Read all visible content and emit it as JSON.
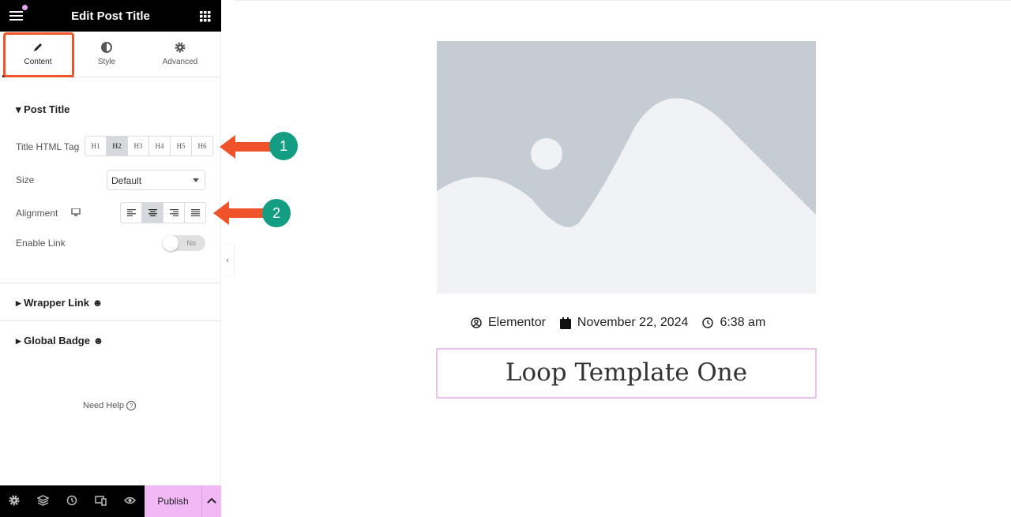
{
  "header": {
    "title": "Edit Post Title",
    "menu_icon": "hamburger-icon",
    "apps_icon": "grid-icon"
  },
  "tabs": [
    {
      "label": "Content",
      "icon": "pencil-icon",
      "active": true
    },
    {
      "label": "Style",
      "icon": "half-circle-icon"
    },
    {
      "label": "Advanced",
      "icon": "gear-icon"
    }
  ],
  "section": {
    "title": "Post Title",
    "html_tag": {
      "label": "Title HTML Tag",
      "options": [
        "H1",
        "H2",
        "H3",
        "H4",
        "H5",
        "H6"
      ],
      "selected": "H2"
    },
    "size": {
      "label": "Size",
      "value": "Default"
    },
    "alignment": {
      "label": "Alignment",
      "device_icon": "desktop-icon",
      "options": [
        "left",
        "center",
        "right",
        "justify"
      ],
      "selected": "center"
    },
    "enable_link": {
      "label": "Enable Link",
      "value": "No"
    }
  },
  "sections": [
    "Wrapper Link",
    "Global Badge"
  ],
  "help": "Need Help",
  "footer": {
    "icons": [
      "gear-icon",
      "layers-icon",
      "history-icon",
      "responsive-icon",
      "eye-icon"
    ],
    "publish": "Publish"
  },
  "annotations": [
    "1",
    "2"
  ],
  "colors": {
    "accent": "#f2b8f5",
    "arrow": "#f0522a",
    "badge": "#139d82"
  },
  "preview": {
    "author": "Elementor",
    "date": "November 22, 2024",
    "time": "6:38 am",
    "title": "Loop Template One"
  }
}
